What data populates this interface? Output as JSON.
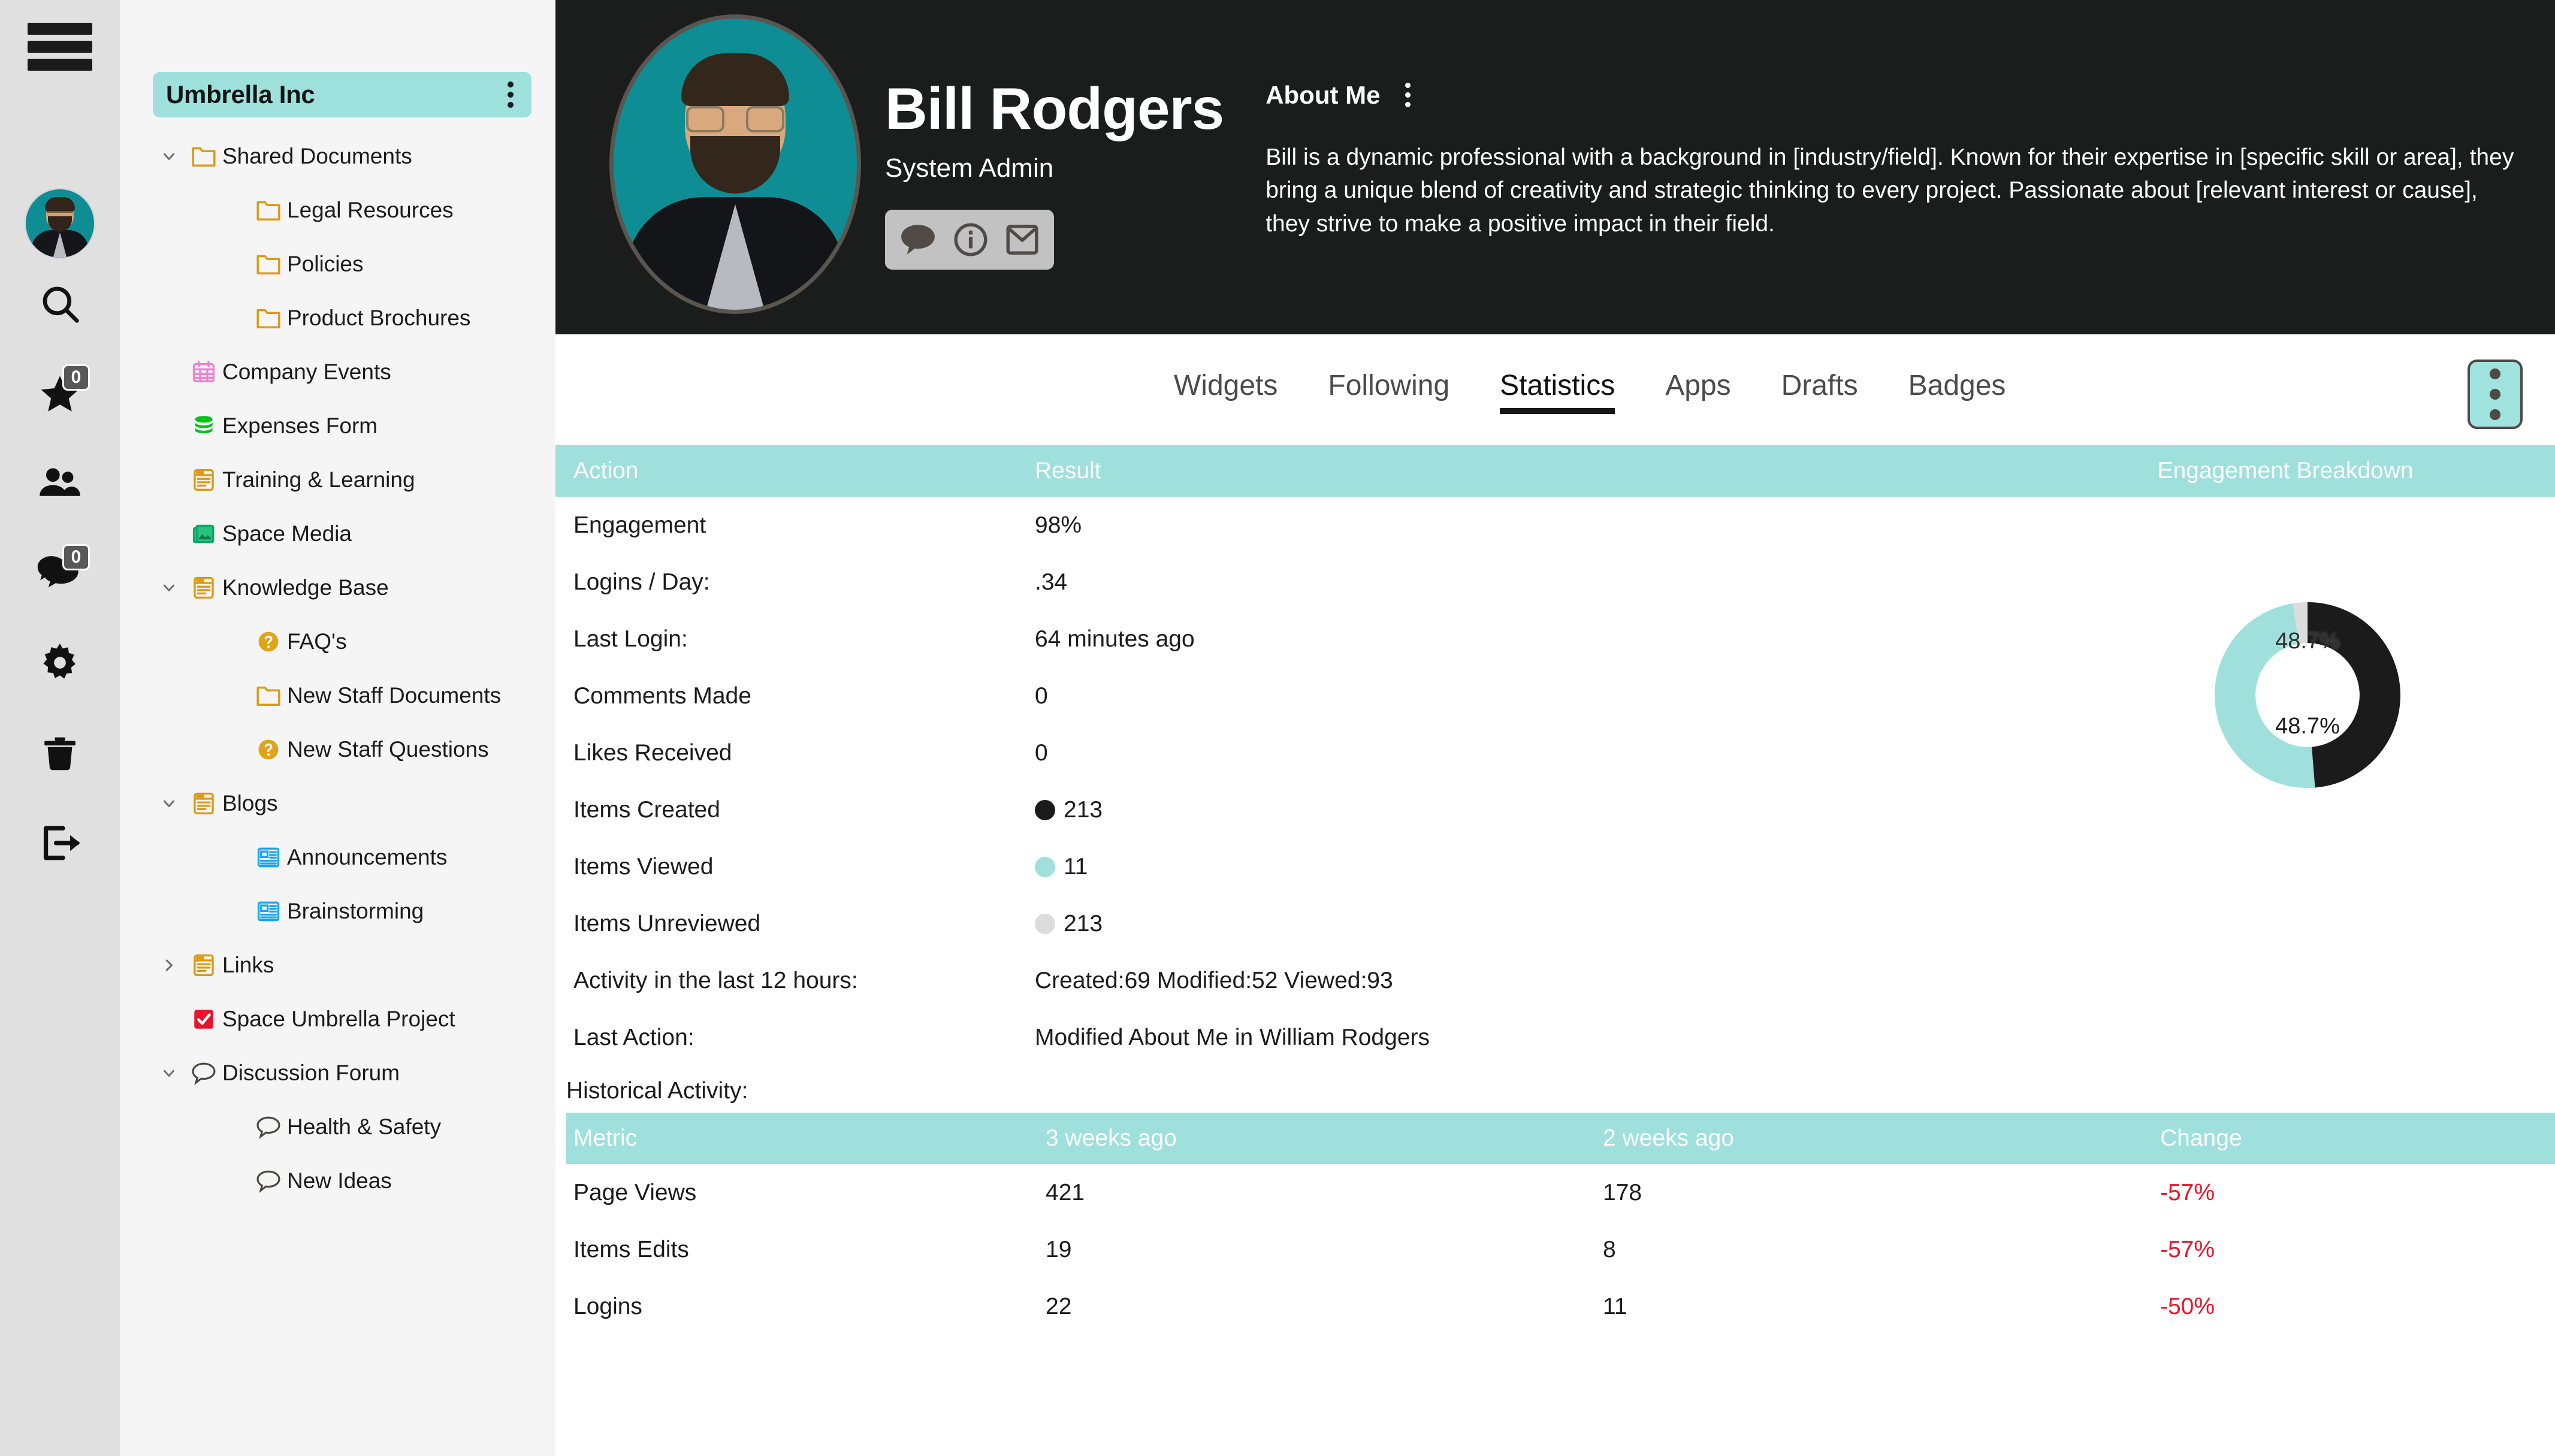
{
  "rail": {
    "hamburger_label": "menu-toggle",
    "items": [
      {
        "name": "search",
        "badge": null
      },
      {
        "name": "favorites",
        "badge": "0"
      },
      {
        "name": "people",
        "badge": null
      },
      {
        "name": "messages",
        "badge": "0"
      },
      {
        "name": "settings",
        "badge": null
      },
      {
        "name": "trash",
        "badge": null
      },
      {
        "name": "logout",
        "badge": null
      }
    ]
  },
  "sidebar": {
    "space_title": "Umbrella Inc",
    "tree": [
      {
        "label": "Shared Documents",
        "level": 1,
        "chevron": "down",
        "icon": "folder"
      },
      {
        "label": "Legal Resources",
        "level": 2,
        "chevron": "none",
        "icon": "folder"
      },
      {
        "label": "Policies",
        "level": 2,
        "chevron": "none",
        "icon": "folder"
      },
      {
        "label": "Product Brochures",
        "level": 2,
        "chevron": "none",
        "icon": "folder"
      },
      {
        "label": "Company Events",
        "level": 1,
        "chevron": "none",
        "icon": "calendar"
      },
      {
        "label": "Expenses Form",
        "level": 1,
        "chevron": "none",
        "icon": "database"
      },
      {
        "label": "Training & Learning",
        "level": 1,
        "chevron": "none",
        "icon": "page"
      },
      {
        "label": "Space Media",
        "level": 1,
        "chevron": "none",
        "icon": "media"
      },
      {
        "label": "Knowledge Base",
        "level": 1,
        "chevron": "down",
        "icon": "page"
      },
      {
        "label": "FAQ's",
        "level": 2,
        "chevron": "none",
        "icon": "question"
      },
      {
        "label": "New Staff Documents",
        "level": 2,
        "chevron": "none",
        "icon": "folder"
      },
      {
        "label": "New Staff Questions",
        "level": 2,
        "chevron": "none",
        "icon": "question"
      },
      {
        "label": "Blogs",
        "level": 1,
        "chevron": "down",
        "icon": "page"
      },
      {
        "label": "Announcements",
        "level": 2,
        "chevron": "none",
        "icon": "news"
      },
      {
        "label": "Brainstorming",
        "level": 2,
        "chevron": "none",
        "icon": "news"
      },
      {
        "label": "Links",
        "level": 1,
        "chevron": "right",
        "icon": "page"
      },
      {
        "label": "Space Umbrella Project",
        "level": 1,
        "chevron": "none",
        "icon": "task"
      },
      {
        "label": "Discussion Forum",
        "level": 1,
        "chevron": "down",
        "icon": "comment"
      },
      {
        "label": "Health & Safety",
        "level": 2,
        "chevron": "none",
        "icon": "comment"
      },
      {
        "label": "New Ideas",
        "level": 2,
        "chevron": "none",
        "icon": "comment"
      }
    ]
  },
  "profile": {
    "name": "Bill Rodgers",
    "role": "System Admin",
    "actions": [
      "comment-icon",
      "info-icon",
      "mail-icon"
    ],
    "about_title": "About Me",
    "about_text": "Bill is a dynamic professional with a background in [industry/field]. Known for their expertise in [specific skill or area], they bring a unique blend of creativity and strategic thinking to every project. Passionate about [relevant interest or cause], they strive to make a positive impact in their field."
  },
  "tabs": [
    {
      "label": "Widgets",
      "active": false
    },
    {
      "label": "Following",
      "active": false
    },
    {
      "label": "Statistics",
      "active": true
    },
    {
      "label": "Apps",
      "active": false
    },
    {
      "label": "Drafts",
      "active": false
    },
    {
      "label": "Badges",
      "active": false
    }
  ],
  "stats_table": {
    "headers": {
      "action": "Action",
      "result": "Result",
      "breakdown": "Engagement Breakdown"
    },
    "rows": [
      {
        "action": "Engagement",
        "result": "98%",
        "dot": null
      },
      {
        "action": "Logins / Day:",
        "result": ".34",
        "dot": null
      },
      {
        "action": "Last Login:",
        "result": "64 minutes ago",
        "dot": null
      },
      {
        "action": "Comments Made",
        "result": "0",
        "dot": null
      },
      {
        "action": "Likes Received",
        "result": "0",
        "dot": null
      },
      {
        "action": "Items Created",
        "result": "213",
        "dot": "#1b1b1b"
      },
      {
        "action": "Items Viewed",
        "result": "11",
        "dot": "#9fe0dc"
      },
      {
        "action": "Items Unreviewed",
        "result": "213",
        "dot": "#dcdcdc"
      },
      {
        "action": "Activity in the last 12 hours:",
        "result": "Created:69 Modified:52 Viewed:93",
        "dot": null
      },
      {
        "action": "Last Action:",
        "result": "Modified About Me in William Rodgers",
        "dot": null
      }
    ]
  },
  "historical": {
    "title": "Historical Activity:",
    "headers": [
      "Metric",
      "3 weeks ago",
      "2 weeks ago",
      "Change"
    ],
    "rows": [
      {
        "metric": "Page Views",
        "w3": "421",
        "w2": "178",
        "change": "-57%"
      },
      {
        "metric": "Items Edits",
        "w3": "19",
        "w2": "8",
        "change": "-57%"
      },
      {
        "metric": "Logins",
        "w3": "22",
        "w2": "11",
        "change": "-50%"
      }
    ]
  },
  "chart_data": {
    "type": "pie",
    "title": "Engagement Breakdown",
    "labels": [
      "Items Created",
      "Items Viewed",
      "Items Unreviewed"
    ],
    "values": [
      213,
      213,
      11
    ],
    "percents": [
      48.7,
      48.7,
      2.6
    ],
    "colors": [
      "#1b1b1b",
      "#9fe0dc",
      "#dcdcdc"
    ],
    "display_labels": {
      "top": "48.7%",
      "bottom": "48.7%"
    },
    "donut": true,
    "legend": "none"
  },
  "colors": {
    "accent_teal": "#9fe0dc",
    "header_dark": "#1b1c1c",
    "rail_bg": "#e0e0e0",
    "sidebar_bg": "#f5f5f5",
    "negative_red": "#e8152b",
    "avatar_bg": "#0e8e94"
  }
}
